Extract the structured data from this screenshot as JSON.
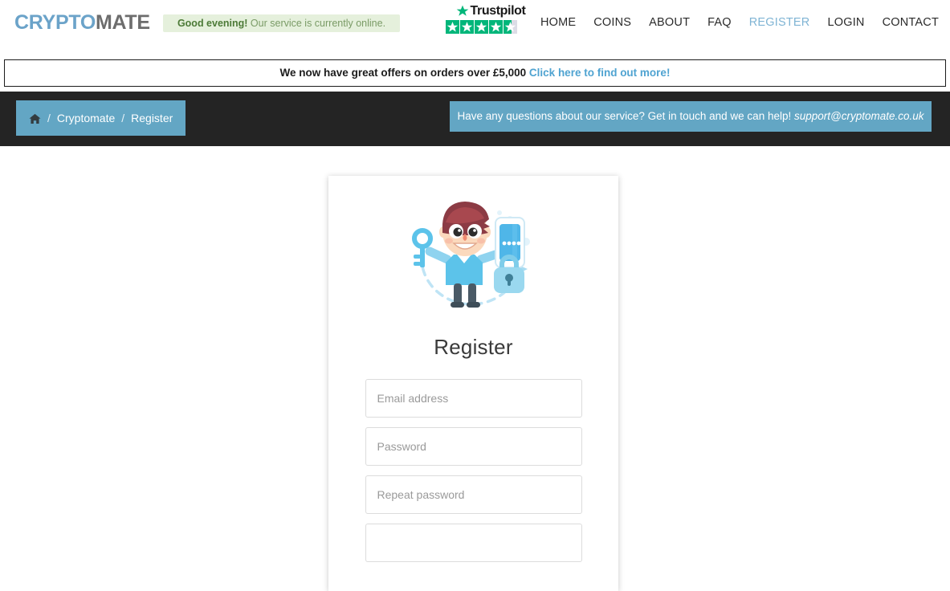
{
  "header": {
    "logo": {
      "part1": "CRYPTO",
      "part2": "MATE",
      "color1": "#6ba3c9",
      "color2": "#6d6d6d"
    },
    "status": {
      "strong": "Good evening!",
      "text": " Our service is currently online.",
      "bg": "#e5f0dc"
    },
    "trustpilot": {
      "name": "Trustpilot",
      "star_icon": "trustpilot-star-icon",
      "rating_stars": 5,
      "filled_stars": 4,
      "partial_fill_percent": 58,
      "star_color": "#00b67a",
      "empty_color": "#dcdce6"
    },
    "nav": [
      {
        "label": "HOME",
        "active": false
      },
      {
        "label": "COINS",
        "active": false
      },
      {
        "label": "ABOUT",
        "active": false
      },
      {
        "label": "FAQ",
        "active": false
      },
      {
        "label": "REGISTER",
        "active": true
      },
      {
        "label": "LOGIN",
        "active": false
      },
      {
        "label": "CONTACT",
        "active": false
      }
    ],
    "nav_active_color": "#7fb4d4"
  },
  "promo": {
    "text": "We now have great offers on orders over £5,000 ",
    "link_label": "Click here to find out more!",
    "link_color": "#4fa3d1"
  },
  "breadcrumb": {
    "home_icon": "home-icon",
    "sep": "/",
    "items": [
      {
        "label": "Cryptomate"
      },
      {
        "label": "Register"
      }
    ],
    "bg": "#63a6c4"
  },
  "support": {
    "text": "Have any questions about our service? Get in touch and we can help! ",
    "email": "support@cryptomate.co.uk",
    "bg": "#63a6c4"
  },
  "register_card": {
    "illustration_name": "register-security-illustration",
    "title": "Register",
    "fields": [
      {
        "name": "email-field",
        "placeholder": "Email address",
        "value": "",
        "type": "text"
      },
      {
        "name": "password-field",
        "placeholder": "Password",
        "value": "",
        "type": "password"
      },
      {
        "name": "repeat-password-field",
        "placeholder": "Repeat password",
        "value": "",
        "type": "password"
      },
      {
        "name": "fourth-field",
        "placeholder": "",
        "value": "",
        "type": "text"
      }
    ]
  },
  "theme": {
    "page_bg": "#ffffff",
    "dark_strip": "#242424",
    "accent_blue": "#63a6c4"
  }
}
